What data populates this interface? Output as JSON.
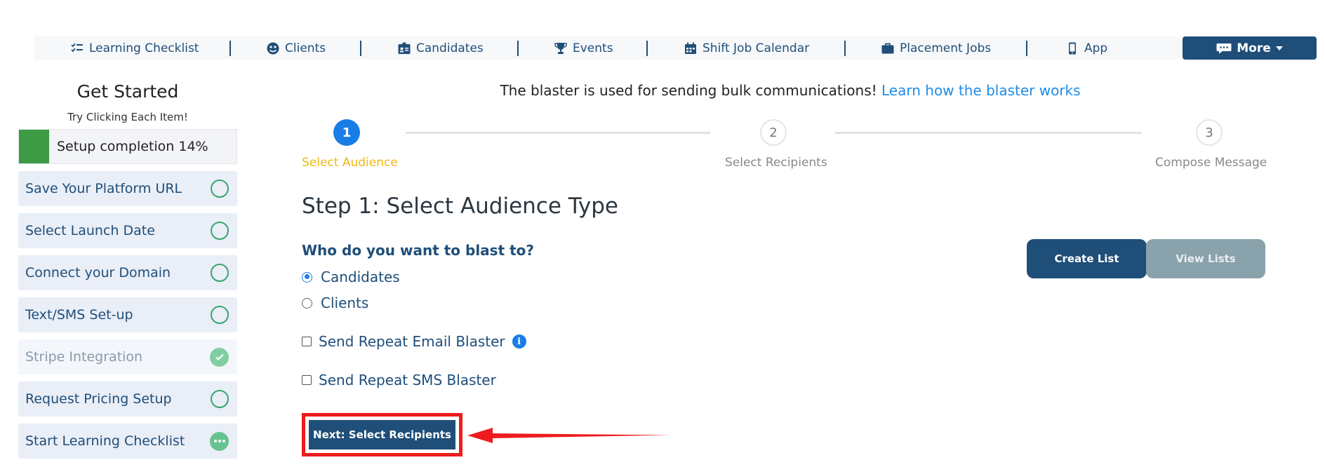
{
  "nav": {
    "items": [
      {
        "label": "Learning Checklist",
        "icon": "checklist-icon"
      },
      {
        "label": "Clients",
        "icon": "user-circle-icon"
      },
      {
        "label": "Candidates",
        "icon": "id-badge-icon"
      },
      {
        "label": "Events",
        "icon": "trophy-icon"
      },
      {
        "label": "Shift Job Calendar",
        "icon": "calendar-icon"
      },
      {
        "label": "Placement Jobs",
        "icon": "briefcase-icon"
      },
      {
        "label": "App",
        "icon": "phone-icon"
      }
    ],
    "more_label": "More"
  },
  "sidebar": {
    "title": "Get Started",
    "subtitle": "Try Clicking Each Item!",
    "progress_label": "Setup completion 14%",
    "progress_percent": 14,
    "items": [
      {
        "label": "Save Your Platform URL",
        "status": "pending"
      },
      {
        "label": "Select Launch Date",
        "status": "pending"
      },
      {
        "label": "Connect your Domain",
        "status": "pending"
      },
      {
        "label": "Text/SMS Set-up",
        "status": "pending"
      },
      {
        "label": "Stripe Integration",
        "status": "done"
      },
      {
        "label": "Request Pricing Setup",
        "status": "pending"
      },
      {
        "label": "Start Learning Checklist",
        "status": "in-progress"
      }
    ]
  },
  "main": {
    "info_text": "The blaster is used for sending bulk communications!",
    "info_link": "Learn how the blaster works",
    "steps": [
      {
        "number": "1",
        "label": "Select Audience"
      },
      {
        "number": "2",
        "label": "Select Recipients"
      },
      {
        "number": "3",
        "label": "Compose Message"
      }
    ],
    "heading": "Step 1: Select Audience Type",
    "question": "Who do you want to blast to?",
    "audience_options": [
      "Candidates",
      "Clients"
    ],
    "selected_audience": "Candidates",
    "repeat_email_label": "Send Repeat Email Blaster",
    "repeat_sms_label": "Send Repeat SMS Blaster",
    "create_list_label": "Create List",
    "view_lists_label": "View Lists",
    "next_label": "Next: Select Recipients"
  },
  "colors": {
    "primary": "#1f4e79",
    "accent_blue": "#1a7de6",
    "active_step": "#f0b914",
    "success": "#3d9a45",
    "highlight": "#ee1c1c"
  }
}
